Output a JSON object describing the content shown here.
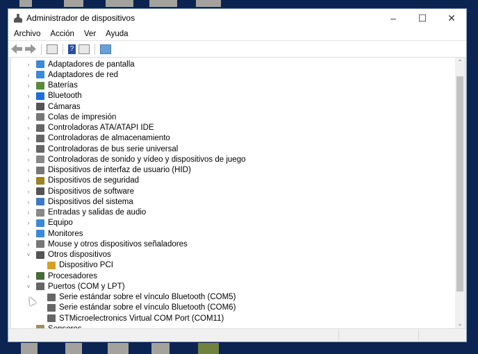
{
  "window": {
    "title": "Administrador de dispositivos",
    "icon": "device-manager-icon"
  },
  "menu": [
    "Archivo",
    "Acción",
    "Ver",
    "Ayuda"
  ],
  "toolbar": [
    "back-icon",
    "forward-icon",
    "properties-icon",
    "help-icon",
    "update-driver-icon",
    "scan-hardware-icon"
  ],
  "tree": [
    {
      "label": "Adaptadores de pantalla",
      "state": "collapsed",
      "color": "#3a8ad8"
    },
    {
      "label": "Adaptadores de red",
      "state": "collapsed",
      "color": "#3a8ad8"
    },
    {
      "label": "Baterías",
      "state": "collapsed",
      "color": "#5a8a3a"
    },
    {
      "label": "Bluetooth",
      "state": "collapsed",
      "color": "#1e6fd8"
    },
    {
      "label": "Cámaras",
      "state": "collapsed",
      "color": "#555"
    },
    {
      "label": "Colas de impresión",
      "state": "collapsed",
      "color": "#777"
    },
    {
      "label": "Controladoras ATA/ATAPI IDE",
      "state": "collapsed",
      "color": "#666"
    },
    {
      "label": "Controladoras de almacenamiento",
      "state": "collapsed",
      "color": "#666"
    },
    {
      "label": "Controladoras de bus serie universal",
      "state": "collapsed",
      "color": "#666"
    },
    {
      "label": "Controladoras de sonido y vídeo y dispositivos de juego",
      "state": "collapsed",
      "color": "#888"
    },
    {
      "label": "Dispositivos de interfaz de usuario (HID)",
      "state": "collapsed",
      "color": "#777"
    },
    {
      "label": "Dispositivos de seguridad",
      "state": "collapsed",
      "color": "#a08020"
    },
    {
      "label": "Dispositivos de software",
      "state": "collapsed",
      "color": "#555"
    },
    {
      "label": "Dispositivos del sistema",
      "state": "collapsed",
      "color": "#3a7ac8"
    },
    {
      "label": "Entradas y salidas de audio",
      "state": "collapsed",
      "color": "#888"
    },
    {
      "label": "Equipo",
      "state": "collapsed",
      "color": "#3a8ad8"
    },
    {
      "label": "Monitores",
      "state": "collapsed",
      "color": "#3a8ad8"
    },
    {
      "label": "Mouse y otros dispositivos señaladores",
      "state": "collapsed",
      "color": "#777"
    },
    {
      "label": "Otros dispositivos",
      "state": "expanded",
      "color": "#555"
    },
    {
      "label": "Dispositivo PCI",
      "child": true,
      "warning": true,
      "color": "#d8a020"
    },
    {
      "label": "Procesadores",
      "state": "collapsed",
      "color": "#4a6a3a"
    },
    {
      "label": "Puertos (COM y LPT)",
      "state": "expanded",
      "color": "#666"
    },
    {
      "label": "Serie estándar sobre el vínculo Bluetooth (COM5)",
      "child": true,
      "color": "#666"
    },
    {
      "label": "Serie estándar sobre el vínculo Bluetooth (COM6)",
      "child": true,
      "color": "#666"
    },
    {
      "label": "STMicroelectronics Virtual COM Port (COM11)",
      "child": true,
      "color": "#666"
    },
    {
      "label": "Sensores",
      "state": "collapsed",
      "color": "#a09060"
    }
  ]
}
